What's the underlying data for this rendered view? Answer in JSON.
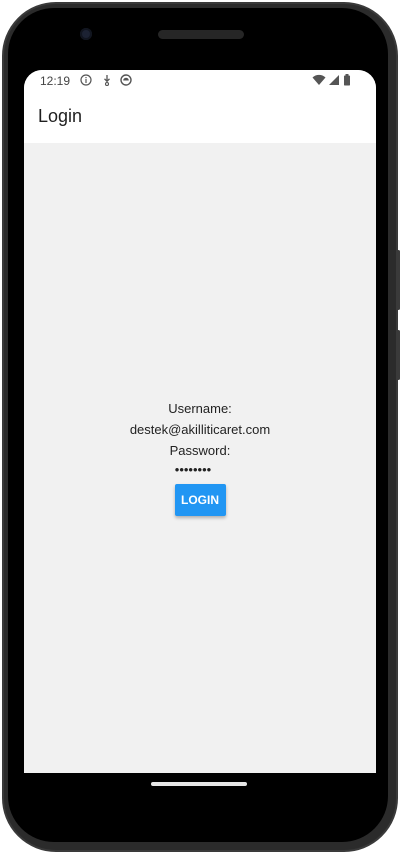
{
  "status_bar": {
    "time": "12:19",
    "left_icons": [
      "info-icon",
      "download-icon",
      "notification-icon"
    ],
    "right_icons": [
      "wifi-icon",
      "cell-signal-icon",
      "battery-icon"
    ]
  },
  "app_bar": {
    "title": "Login"
  },
  "form": {
    "username_label": "Username:",
    "username_value": "destek@akilliticaret.com",
    "password_label": "Password:",
    "password_value": "••••••••",
    "login_button": "LOGIN"
  },
  "colors": {
    "accent": "#2196f3",
    "background": "#f1f1f1",
    "app_bar": "#ffffff"
  }
}
